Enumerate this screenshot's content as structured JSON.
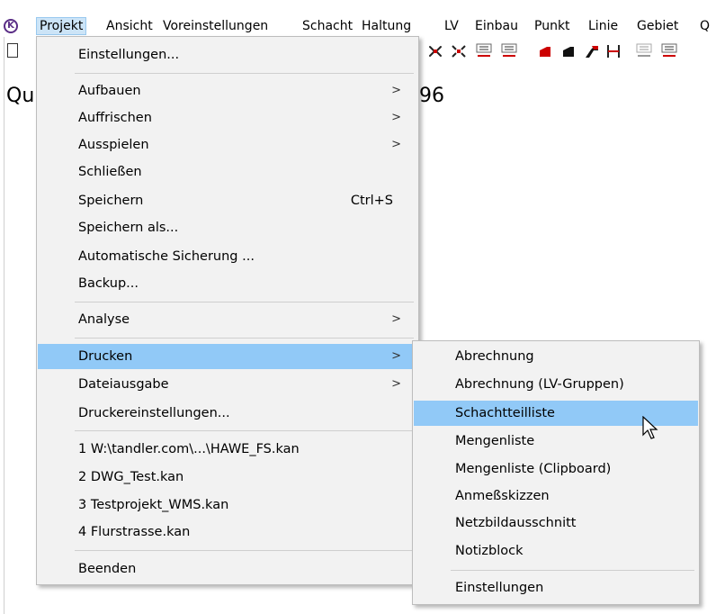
{
  "menubar": {
    "items": [
      "Projekt",
      "Ansicht",
      "Voreinstellungen",
      "Schacht",
      "Haltung",
      "LV",
      "Einbau",
      "Punkt",
      "Linie",
      "Gebiet",
      "Q"
    ]
  },
  "canvas": {
    "left_text": "Qu",
    "right_text": "96"
  },
  "projekt_menu": {
    "settings": "Einstellungen...",
    "aufbauen": "Aufbauen",
    "auffrischen": "Auffrischen",
    "ausspielen": "Ausspielen",
    "schliessen": "Schließen",
    "speichern": "Speichern",
    "speichern_shortcut": "Ctrl+S",
    "speichern_als": "Speichern als...",
    "auto_sicherung": "Automatische Sicherung ...",
    "backup": "Backup...",
    "analyse": "Analyse",
    "drucken": "Drucken",
    "dateiausgabe": "Dateiausgabe",
    "druckereinstellungen": "Druckereinstellungen...",
    "recent": [
      "1 W:\\tandler.com\\...\\HAWE_FS.kan",
      "2 DWG_Test.kan",
      "3 Testprojekt_WMS.kan",
      "4 Flurstrasse.kan"
    ],
    "beenden": "Beenden",
    "arrow": ">"
  },
  "drucken_menu": {
    "items": [
      "Abrechnung",
      "Abrechnung (LV-Gruppen)",
      "Schachtteilliste",
      "Mengenliste",
      "Mengenliste (Clipboard)",
      "Anmeßskizzen",
      "Netzbildausschnitt",
      "Notizblock"
    ],
    "einstellungen": "Einstellungen"
  },
  "colors": {
    "highlight": "#91c9f7",
    "menu_bg": "#f2f2f2",
    "menubar_active": "#cce4f7",
    "toolbar_red": "#cc0000"
  },
  "icons": {
    "app_logo": "K-circle-logo",
    "cursor": "mouse-pointer-icon"
  }
}
